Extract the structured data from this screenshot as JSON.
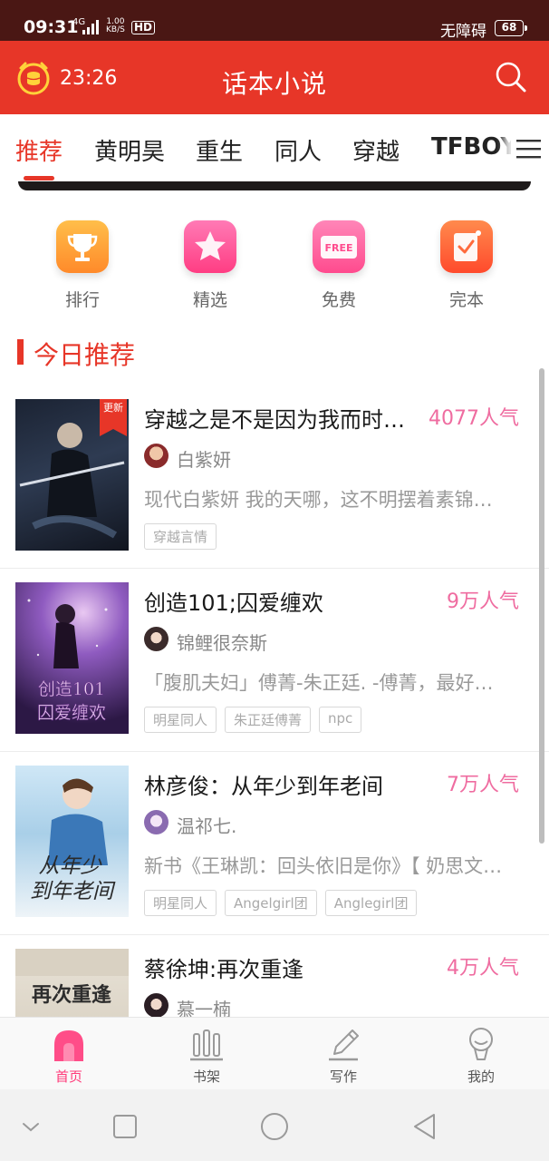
{
  "status_bar": {
    "time": "09:31",
    "network": "4G",
    "speed_value": "1.00",
    "speed_unit": "KB/S",
    "hd": "HD",
    "accessibility": "无障碍",
    "battery": "68"
  },
  "app_bar": {
    "timer": "23:26",
    "title": "话本小说",
    "icons": [
      "alarm-clock-coin-icon",
      "search-icon"
    ]
  },
  "category_tabs": {
    "items": [
      {
        "label": "推荐",
        "active": true
      },
      {
        "label": "黄明昊",
        "active": false
      },
      {
        "label": "重生",
        "active": false
      },
      {
        "label": "同人",
        "active": false
      },
      {
        "label": "穿越",
        "active": false
      },
      {
        "label": "TFBOYS",
        "active": false
      }
    ],
    "menu_icon": "menu-icon"
  },
  "quick_links": [
    {
      "label": "排行",
      "icon": "trophy-icon",
      "color": "#ffa53a"
    },
    {
      "label": "精选",
      "icon": "star-icon",
      "color": "#ff5fa0"
    },
    {
      "label": "免费",
      "icon": "free-tag-icon",
      "badge_text": "FREE",
      "color": "#ff6fa8"
    },
    {
      "label": "完本",
      "icon": "checklist-icon",
      "color": "#ff6a3c"
    }
  ],
  "section": {
    "title": "今日推荐"
  },
  "books": [
    {
      "title": "穿越之是不是因为我而时…",
      "popularity": "4077人气",
      "author": "白紫妍",
      "description": "现代白紫妍 我的天哪，这不明摆着素锦…",
      "tags": [
        "穿越言情"
      ],
      "badge": "更新"
    },
    {
      "title": "创造101;囚爱缠欢",
      "popularity": "9万人气",
      "author": "锦鲤很奈斯",
      "description": "「腹肌夫妇」傅菁-朱正廷. -傅菁，最好…",
      "tags": [
        "明星同人",
        "朱正廷傅菁",
        "npc"
      ],
      "cover_text": "创造101 囚爱缠欢"
    },
    {
      "title": "林彦俊：从年少到年老间",
      "popularity": "7万人气",
      "author": "温祁七.",
      "description": "新书《王琳凯：回头依旧是你》【 奶思文…",
      "tags": [
        "明星同人",
        "Angelgirl团",
        "Anglegirl团"
      ],
      "cover_text": "从年少到年老间"
    },
    {
      "title": "蔡徐坤:再次重逢",
      "popularity": "4万人气",
      "author": "慕一楠",
      "description": "",
      "tags": [],
      "cover_text": "再次重逢"
    }
  ],
  "bottom_nav": [
    {
      "label": "首页",
      "icon": "home-icon",
      "active": true
    },
    {
      "label": "书架",
      "icon": "bookshelf-icon",
      "active": false
    },
    {
      "label": "写作",
      "icon": "pencil-icon",
      "active": false
    },
    {
      "label": "我的",
      "icon": "profile-icon",
      "active": false
    }
  ],
  "system_nav": [
    "collapse-chevron-icon",
    "recents-square-icon",
    "home-circle-icon",
    "back-triangle-icon"
  ],
  "colors": {
    "status_bar": "#4a1714",
    "brand_red": "#e73628",
    "popularity_pink": "#ef6ca0",
    "active_nav_pink": "#ff3b7a"
  }
}
